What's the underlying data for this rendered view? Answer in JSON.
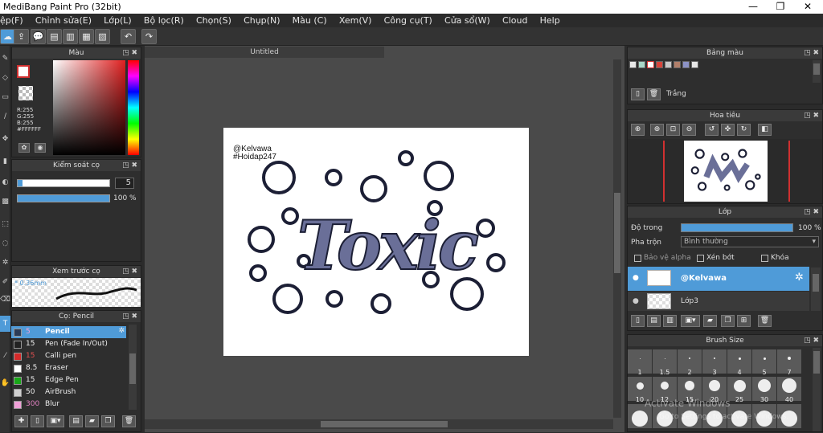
{
  "app": {
    "title": "MediBang Paint Pro (32bit)",
    "win_minimize": "—",
    "win_maximize": "❐",
    "win_close": "✕"
  },
  "menu": [
    "ệp(F)",
    "Chỉnh sửa(E)",
    "Lớp(L)",
    "Bộ lọc(R)",
    "Chọn(S)",
    "Chụp(N)",
    "Màu (C)",
    "Xem(V)",
    "Công cụ(T)",
    "Cửa sổ(W)",
    "Cloud",
    "Help"
  ],
  "document": {
    "tab_label": "Untitled",
    "watermark_line1": "@Kelvawa",
    "watermark_line2": "#Hoidap247",
    "art_text": "Toxic"
  },
  "color_panel": {
    "title": "Màu",
    "r": "R:255",
    "g": "G:255",
    "b": "B:255",
    "hex": "#FFFFFF"
  },
  "brush_control": {
    "title": "Kiểm soát cọ",
    "size_value": "5",
    "opacity_value": "100 %"
  },
  "preview": {
    "title": "Xem trước cọ",
    "size_label": "* 0.36mm"
  },
  "brushes": {
    "title": "Cọ: Pencil",
    "items": [
      {
        "size": "5",
        "name": "Pencil",
        "color": "#2b3c57"
      },
      {
        "size": "15",
        "name": "Pen (Fade In/Out)",
        "color": "#222222"
      },
      {
        "size": "15",
        "name": "Calli pen",
        "color": "#d42a2a"
      },
      {
        "size": "8.5",
        "name": "Eraser",
        "color": "#ffffff"
      },
      {
        "size": "15",
        "name": "Edge Pen",
        "color": "#18a818"
      },
      {
        "size": "50",
        "name": "AirBrush",
        "color": "#cfcfcf"
      },
      {
        "size": "300",
        "name": "Blur",
        "color": "#f0a0d8"
      }
    ]
  },
  "palette": {
    "title": "Bảng màu",
    "current_name": "Trắng",
    "swatches": [
      "#e8e8e8",
      "#a9d7c8",
      "#ffffff",
      "#d8443a",
      "#c8c8c8",
      "#b27f6a",
      "#8c93c6",
      "#e6e6e6"
    ]
  },
  "navigator": {
    "title": "Hoa tiêu"
  },
  "layer_panel": {
    "title": "Lớp",
    "opacity_label": "Độ trong",
    "opacity_value": "100 %",
    "opacity_fraction": 1.0,
    "blend_label": "Pha trộn",
    "blend_value": "Bình thường",
    "protect_alpha": "Bảo vệ alpha",
    "clipping": "Xén bớt",
    "lock": "Khóa",
    "layers": [
      {
        "name": "@Kelvawa",
        "selected": true
      },
      {
        "name": "Lớp3",
        "selected": false
      }
    ]
  },
  "brush_size": {
    "title": "Brush Size",
    "row1": [
      "1",
      "1.5",
      "2",
      "3",
      "4",
      "5",
      "7"
    ],
    "row2": [
      "10",
      "12",
      "15",
      "20",
      "25",
      "30",
      "40"
    ]
  },
  "watermark": {
    "line1": "Activate Windows",
    "line2": "Go to Settings to activate Windows."
  },
  "colors": {
    "accent": "#4f9bd8",
    "art": "#6a6f98"
  }
}
